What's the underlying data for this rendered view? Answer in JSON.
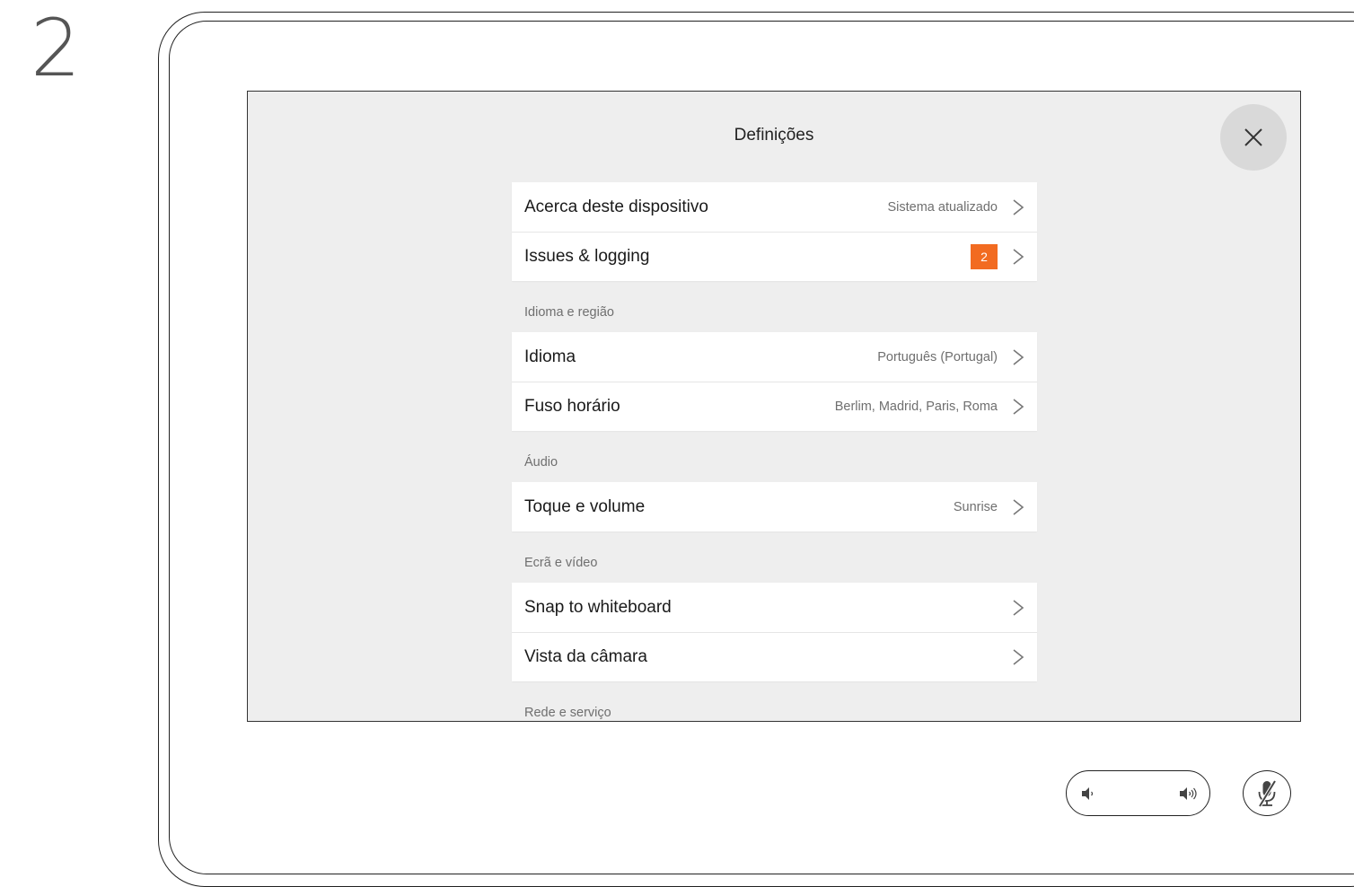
{
  "step_number": "2",
  "screen": {
    "title": "Definições",
    "close_icon": "close-icon"
  },
  "groups": [
    {
      "header": "",
      "rows": [
        {
          "label": "Acerca deste dispositivo",
          "value": "Sistema atualizado"
        },
        {
          "label": "Issues & logging",
          "badge": "2",
          "badge_color": "#f26b21"
        }
      ]
    },
    {
      "header": "Idioma e região",
      "rows": [
        {
          "label": "Idioma",
          "value": "Português (Portugal)"
        },
        {
          "label": "Fuso horário",
          "value": "Berlim, Madrid, Paris, Roma"
        }
      ]
    },
    {
      "header": "Áudio",
      "rows": [
        {
          "label": "Toque e volume",
          "value": "Sunrise"
        }
      ]
    },
    {
      "header": "Ecrã e vídeo",
      "rows": [
        {
          "label": "Snap to whiteboard"
        },
        {
          "label": "Vista da câmara"
        }
      ]
    },
    {
      "header": "Rede e serviço",
      "rows": []
    }
  ],
  "controls": {
    "volume_down_icon": "volume-down-icon",
    "volume_up_icon": "volume-up-icon",
    "mute_icon": "microphone-muted-icon"
  },
  "colors": {
    "screen_bg": "#eeeeee",
    "badge": "#f26b21",
    "secondary_text": "#6f6f6f"
  }
}
